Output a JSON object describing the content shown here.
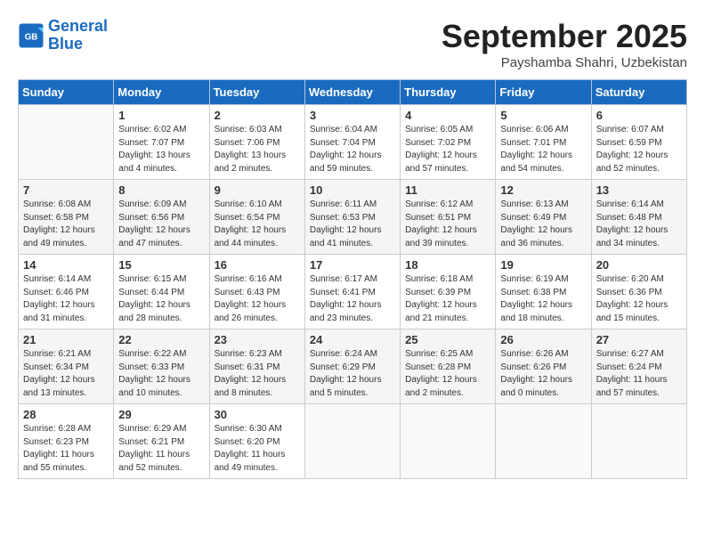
{
  "header": {
    "logo_line1": "General",
    "logo_line2": "Blue",
    "month": "September 2025",
    "location": "Payshamba Shahri, Uzbekistan"
  },
  "weekdays": [
    "Sunday",
    "Monday",
    "Tuesday",
    "Wednesday",
    "Thursday",
    "Friday",
    "Saturday"
  ],
  "weeks": [
    [
      {
        "day": "",
        "info": ""
      },
      {
        "day": "1",
        "info": "Sunrise: 6:02 AM\nSunset: 7:07 PM\nDaylight: 13 hours\nand 4 minutes."
      },
      {
        "day": "2",
        "info": "Sunrise: 6:03 AM\nSunset: 7:06 PM\nDaylight: 13 hours\nand 2 minutes."
      },
      {
        "day": "3",
        "info": "Sunrise: 6:04 AM\nSunset: 7:04 PM\nDaylight: 12 hours\nand 59 minutes."
      },
      {
        "day": "4",
        "info": "Sunrise: 6:05 AM\nSunset: 7:02 PM\nDaylight: 12 hours\nand 57 minutes."
      },
      {
        "day": "5",
        "info": "Sunrise: 6:06 AM\nSunset: 7:01 PM\nDaylight: 12 hours\nand 54 minutes."
      },
      {
        "day": "6",
        "info": "Sunrise: 6:07 AM\nSunset: 6:59 PM\nDaylight: 12 hours\nand 52 minutes."
      }
    ],
    [
      {
        "day": "7",
        "info": "Sunrise: 6:08 AM\nSunset: 6:58 PM\nDaylight: 12 hours\nand 49 minutes."
      },
      {
        "day": "8",
        "info": "Sunrise: 6:09 AM\nSunset: 6:56 PM\nDaylight: 12 hours\nand 47 minutes."
      },
      {
        "day": "9",
        "info": "Sunrise: 6:10 AM\nSunset: 6:54 PM\nDaylight: 12 hours\nand 44 minutes."
      },
      {
        "day": "10",
        "info": "Sunrise: 6:11 AM\nSunset: 6:53 PM\nDaylight: 12 hours\nand 41 minutes."
      },
      {
        "day": "11",
        "info": "Sunrise: 6:12 AM\nSunset: 6:51 PM\nDaylight: 12 hours\nand 39 minutes."
      },
      {
        "day": "12",
        "info": "Sunrise: 6:13 AM\nSunset: 6:49 PM\nDaylight: 12 hours\nand 36 minutes."
      },
      {
        "day": "13",
        "info": "Sunrise: 6:14 AM\nSunset: 6:48 PM\nDaylight: 12 hours\nand 34 minutes."
      }
    ],
    [
      {
        "day": "14",
        "info": "Sunrise: 6:14 AM\nSunset: 6:46 PM\nDaylight: 12 hours\nand 31 minutes."
      },
      {
        "day": "15",
        "info": "Sunrise: 6:15 AM\nSunset: 6:44 PM\nDaylight: 12 hours\nand 28 minutes."
      },
      {
        "day": "16",
        "info": "Sunrise: 6:16 AM\nSunset: 6:43 PM\nDaylight: 12 hours\nand 26 minutes."
      },
      {
        "day": "17",
        "info": "Sunrise: 6:17 AM\nSunset: 6:41 PM\nDaylight: 12 hours\nand 23 minutes."
      },
      {
        "day": "18",
        "info": "Sunrise: 6:18 AM\nSunset: 6:39 PM\nDaylight: 12 hours\nand 21 minutes."
      },
      {
        "day": "19",
        "info": "Sunrise: 6:19 AM\nSunset: 6:38 PM\nDaylight: 12 hours\nand 18 minutes."
      },
      {
        "day": "20",
        "info": "Sunrise: 6:20 AM\nSunset: 6:36 PM\nDaylight: 12 hours\nand 15 minutes."
      }
    ],
    [
      {
        "day": "21",
        "info": "Sunrise: 6:21 AM\nSunset: 6:34 PM\nDaylight: 12 hours\nand 13 minutes."
      },
      {
        "day": "22",
        "info": "Sunrise: 6:22 AM\nSunset: 6:33 PM\nDaylight: 12 hours\nand 10 minutes."
      },
      {
        "day": "23",
        "info": "Sunrise: 6:23 AM\nSunset: 6:31 PM\nDaylight: 12 hours\nand 8 minutes."
      },
      {
        "day": "24",
        "info": "Sunrise: 6:24 AM\nSunset: 6:29 PM\nDaylight: 12 hours\nand 5 minutes."
      },
      {
        "day": "25",
        "info": "Sunrise: 6:25 AM\nSunset: 6:28 PM\nDaylight: 12 hours\nand 2 minutes."
      },
      {
        "day": "26",
        "info": "Sunrise: 6:26 AM\nSunset: 6:26 PM\nDaylight: 12 hours\nand 0 minutes."
      },
      {
        "day": "27",
        "info": "Sunrise: 6:27 AM\nSunset: 6:24 PM\nDaylight: 11 hours\nand 57 minutes."
      }
    ],
    [
      {
        "day": "28",
        "info": "Sunrise: 6:28 AM\nSunset: 6:23 PM\nDaylight: 11 hours\nand 55 minutes."
      },
      {
        "day": "29",
        "info": "Sunrise: 6:29 AM\nSunset: 6:21 PM\nDaylight: 11 hours\nand 52 minutes."
      },
      {
        "day": "30",
        "info": "Sunrise: 6:30 AM\nSunset: 6:20 PM\nDaylight: 11 hours\nand 49 minutes."
      },
      {
        "day": "",
        "info": ""
      },
      {
        "day": "",
        "info": ""
      },
      {
        "day": "",
        "info": ""
      },
      {
        "day": "",
        "info": ""
      }
    ]
  ]
}
